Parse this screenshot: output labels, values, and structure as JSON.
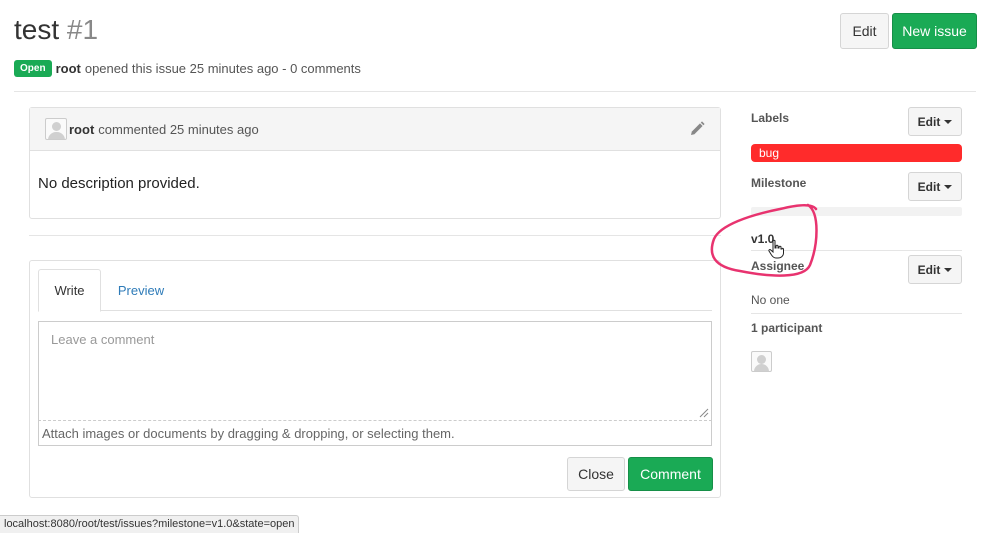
{
  "issue": {
    "title": "test",
    "number": "#1",
    "status": "Open",
    "author": "root",
    "opened_text": "opened this issue 25 minutes ago - 0 comments"
  },
  "header_buttons": {
    "edit_label": "Edit",
    "new_issue_label": "New issue"
  },
  "note": {
    "author": "root",
    "meta": "commented 25 minutes ago",
    "body": "No description provided."
  },
  "comment_form": {
    "tab_write": "Write",
    "tab_preview": "Preview",
    "placeholder": "Leave a comment",
    "attach_hint": "Attach images or documents by dragging & dropping, or selecting them.",
    "close_label": "Close",
    "comment_label": "Comment"
  },
  "sidebar": {
    "labels_title": "Labels",
    "labels_edit": "Edit",
    "label_bug": "bug",
    "milestone_title": "Milestone",
    "milestone_edit": "Edit",
    "milestone_value": "v1.0",
    "assignee_title": "Assignee",
    "assignee_edit": "Edit",
    "assignee_value": "No one",
    "participants_title": "1 participant"
  },
  "status_bar": {
    "url": "localhost:8080/root/test/issues?milestone=v1.0&state=open"
  },
  "colors": {
    "green": "#1aaa55",
    "label_bug": "#ff2b2b",
    "link": "#2e7bb8",
    "annotation": "#e8336f"
  }
}
